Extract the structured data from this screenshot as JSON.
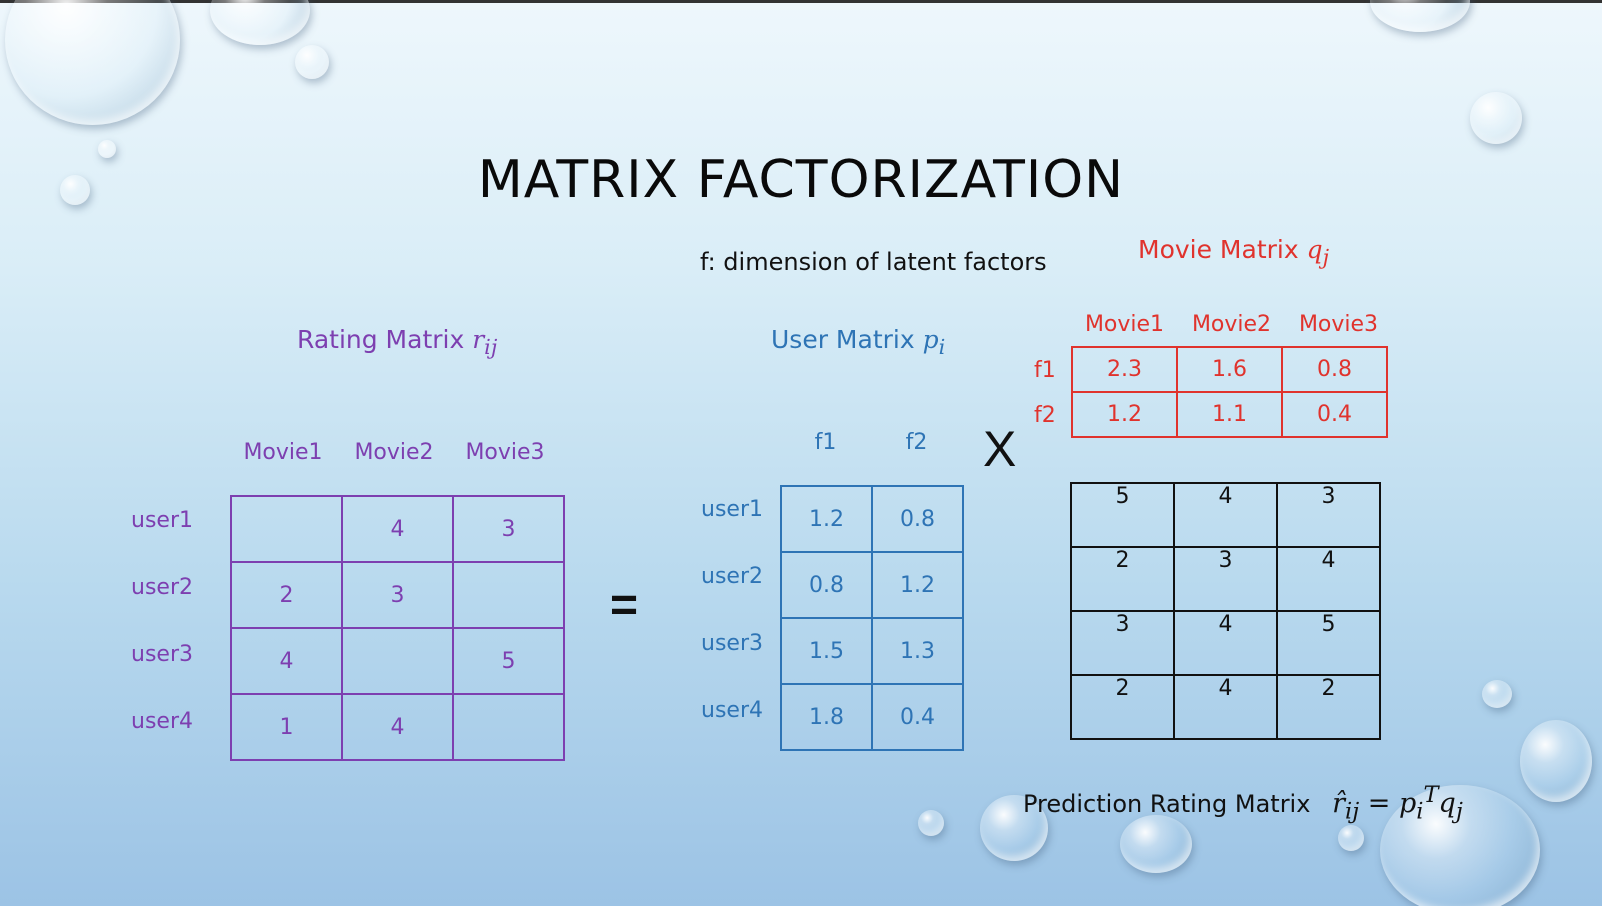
{
  "title": "MATRIX FACTORIZATION",
  "subtitle": "f: dimension of latent factors",
  "rating_matrix": {
    "title": "Rating Matrix",
    "symbol": "r",
    "symbol_sub": "ij",
    "columns": [
      "Movie1",
      "Movie2",
      "Movie3"
    ],
    "rows": [
      {
        "label": "user1",
        "values": [
          "",
          "4",
          "3"
        ]
      },
      {
        "label": "user2",
        "values": [
          "2",
          "3",
          ""
        ]
      },
      {
        "label": "user3",
        "values": [
          "4",
          "",
          "5"
        ]
      },
      {
        "label": "user4",
        "values": [
          "1",
          "4",
          ""
        ]
      }
    ]
  },
  "user_matrix": {
    "title": "User Matrix",
    "symbol": "p",
    "symbol_sub": "i",
    "columns": [
      "f1",
      "f2"
    ],
    "rows": [
      {
        "label": "user1",
        "values": [
          "1.2",
          "0.8"
        ]
      },
      {
        "label": "user2",
        "values": [
          "0.8",
          "1.2"
        ]
      },
      {
        "label": "user3",
        "values": [
          "1.5",
          "1.3"
        ]
      },
      {
        "label": "user4",
        "values": [
          "1.8",
          "0.4"
        ]
      }
    ]
  },
  "movie_matrix": {
    "title": "Movie Matrix",
    "symbol": "q",
    "symbol_sub": "j",
    "columns": [
      "Movie1",
      "Movie2",
      "Movie3"
    ],
    "rows": [
      {
        "label": "f1",
        "values": [
          "2.3",
          "1.6",
          "0.8"
        ]
      },
      {
        "label": "f2",
        "values": [
          "1.2",
          "1.1",
          "0.4"
        ]
      }
    ]
  },
  "prediction_matrix": {
    "title": "Prediction Rating Matrix",
    "formula_lhs": "r̂",
    "formula_lhs_sub": "ij",
    "formula_eq": "=",
    "formula_p": "p",
    "formula_p_sub": "i",
    "formula_p_sup": "T",
    "formula_q": "q",
    "formula_q_sub": "j",
    "rows": [
      [
        "5",
        "4",
        "3"
      ],
      [
        "2",
        "3",
        "4"
      ],
      [
        "3",
        "4",
        "5"
      ],
      [
        "2",
        "4",
        "2"
      ]
    ]
  },
  "operators": {
    "equals": "=",
    "times": "X"
  },
  "colors": {
    "rating": "#7d3fb0",
    "user": "#2e74b5",
    "movie": "#e0332d",
    "prediction": "#111111"
  }
}
